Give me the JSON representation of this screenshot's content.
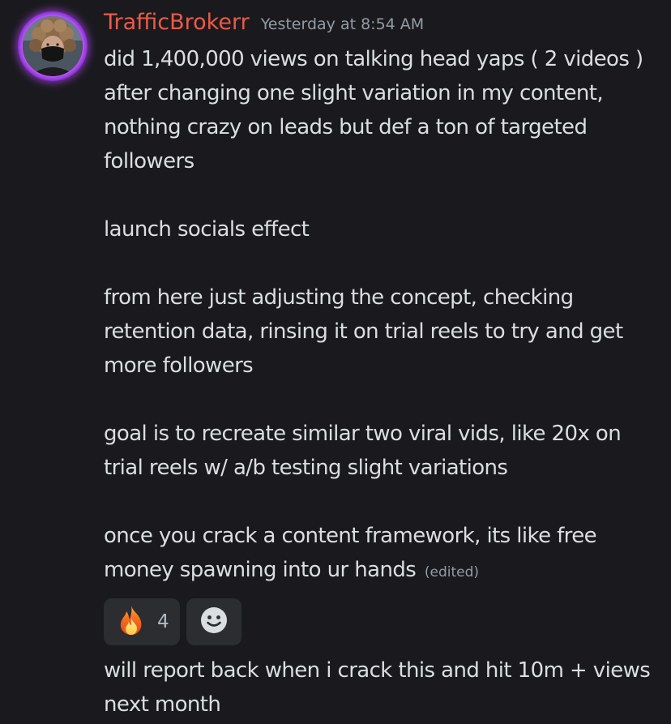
{
  "message": {
    "username": "TrafficBrokerr",
    "timestamp": "Yesterday at 8:54 AM",
    "paragraphs": [
      "did 1,400,000 views on talking head yaps ( 2 videos ) after changing one slight variation in my content, nothing crazy on leads but def a ton of targeted followers",
      "launch socials effect",
      "from here just adjusting the concept, checking retention data, rinsing it on trial reels to try and get more followers",
      "goal is to recreate similar two viral vids, like 20x on trial reels w/ a/b testing slight variations",
      "once you crack a content framework, its like free money spawning into ur hands"
    ],
    "edited_label": "(edited)"
  },
  "reactions": {
    "fire": {
      "icon": "fire-icon",
      "count": "4"
    },
    "add": {
      "icon": "add-reaction-icon"
    }
  },
  "followup": {
    "text": "will report back when i crack this and hit 10m + views next month"
  },
  "colors": {
    "background": "#1a1a1e",
    "username": "#ec5a47",
    "text": "#dbdee1",
    "muted": "#949ba4",
    "reaction_bg": "#2b2d31",
    "avatar_ring": "#e36cff"
  }
}
